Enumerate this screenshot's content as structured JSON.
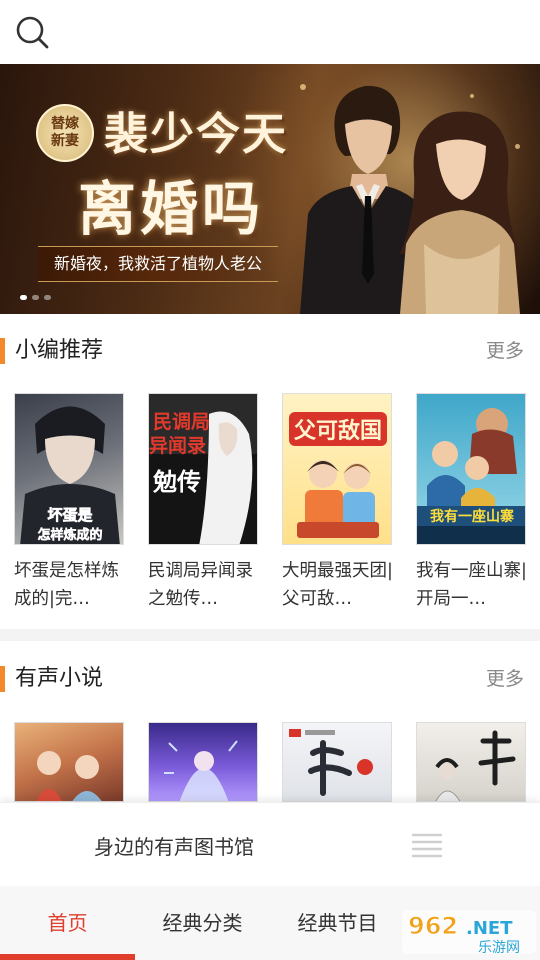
{
  "header": {
    "search_icon": "search-icon"
  },
  "banner": {
    "seal_line1": "替嫁",
    "seal_line2": "新妻",
    "title_line1": "裴少今天",
    "title_line2": "离婚吗",
    "subtitle": "新婚夜，我救活了植物人老公",
    "active_index": 0,
    "slide_count": 3
  },
  "recommend": {
    "title": "小编推荐",
    "more": "更多",
    "books": [
      {
        "title": "坏蛋是怎样炼成的|完…",
        "cover_text": "坏蛋是怎样炼成的"
      },
      {
        "title": "民调局异闻录之勉传…",
        "cover_text": "民调局异闻录之勉传"
      },
      {
        "title": "大明最强天团|父可敌…",
        "cover_text": "父可敌国"
      },
      {
        "title": "我有一座山寨|开局一…",
        "cover_text": "我有一座山寨"
      }
    ]
  },
  "audio": {
    "title": "有声小说",
    "more": "更多",
    "covers": [
      "cover-1",
      "cover-2",
      "cover-3",
      "cover-4"
    ]
  },
  "player": {
    "text": "身边的有声图书馆",
    "icon": "playlist-icon"
  },
  "tabs": [
    {
      "label": "首页",
      "active": true
    },
    {
      "label": "经典分类",
      "active": false
    },
    {
      "label": "经典节目",
      "active": false
    },
    {
      "label": "",
      "active": false
    }
  ],
  "watermark": {
    "text": "962.NET",
    "subtext": "乐游网"
  },
  "colors": {
    "accent": "#e03e2d",
    "section_bar": "#f38a2a"
  }
}
